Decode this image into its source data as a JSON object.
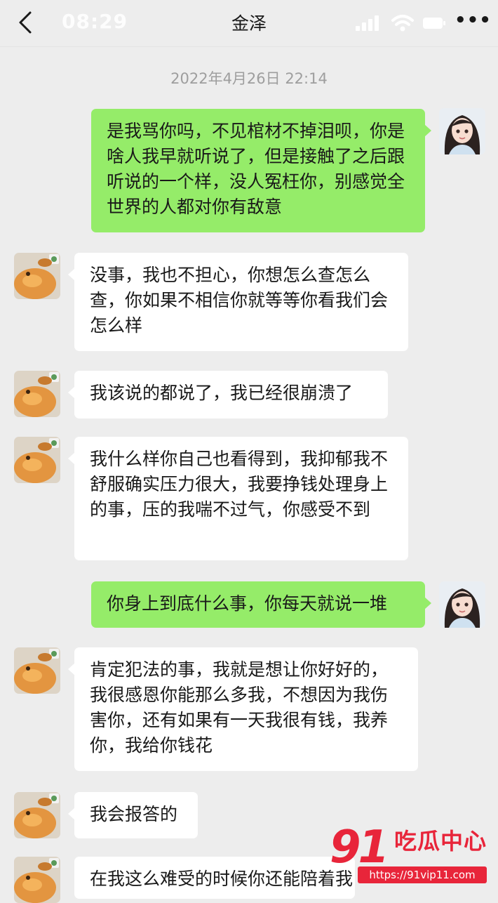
{
  "header": {
    "back_icon": "chevron-left-icon",
    "time": "08:29",
    "title": "金泽",
    "more_label": "•••",
    "status_icons": [
      "signal-icon",
      "wifi-icon",
      "battery-icon"
    ]
  },
  "timestamp": "2022年4月26日 22:14",
  "messages": [
    {
      "side": "out",
      "text": "是我骂你吗，不见棺材不掉泪呗，你是啥人我早就听说了，但是接触了之后跟听说的一个样，没人冤枉你，别感觉全世界的人都对你有敌意"
    },
    {
      "side": "in",
      "text": "没事，我也不担心，你想怎么查怎么查，你如果不相信你就等等你看我们会怎么样"
    },
    {
      "side": "in",
      "text": "我该说的都说了，我已经很崩溃了"
    },
    {
      "side": "in",
      "text": "我什么样你自己也看得到，我抑郁我不舒服确实压力很大，我要挣钱处理身上的事，压的我喘不过气，你感受不到"
    },
    {
      "side": "out",
      "text": "你身上到底什么事，你每天就说一堆"
    },
    {
      "side": "in",
      "text": "肯定犯法的事，我就是想让你好好的，我很感恩你能那么多我，不想因为我伤害你，还有如果有一天我很有钱，我养你，我给你钱花"
    },
    {
      "side": "in",
      "text": "我会报答的"
    },
    {
      "side": "in",
      "text": "在我这么难受的时候你还能陪着我"
    }
  ],
  "watermark": {
    "number": "91",
    "name": "吃瓜中心",
    "url": "https://91vip11.com"
  },
  "colors": {
    "background": "#ededed",
    "outgoing_bubble": "#95ec69",
    "incoming_bubble": "#ffffff",
    "watermark": "#e8253a"
  }
}
